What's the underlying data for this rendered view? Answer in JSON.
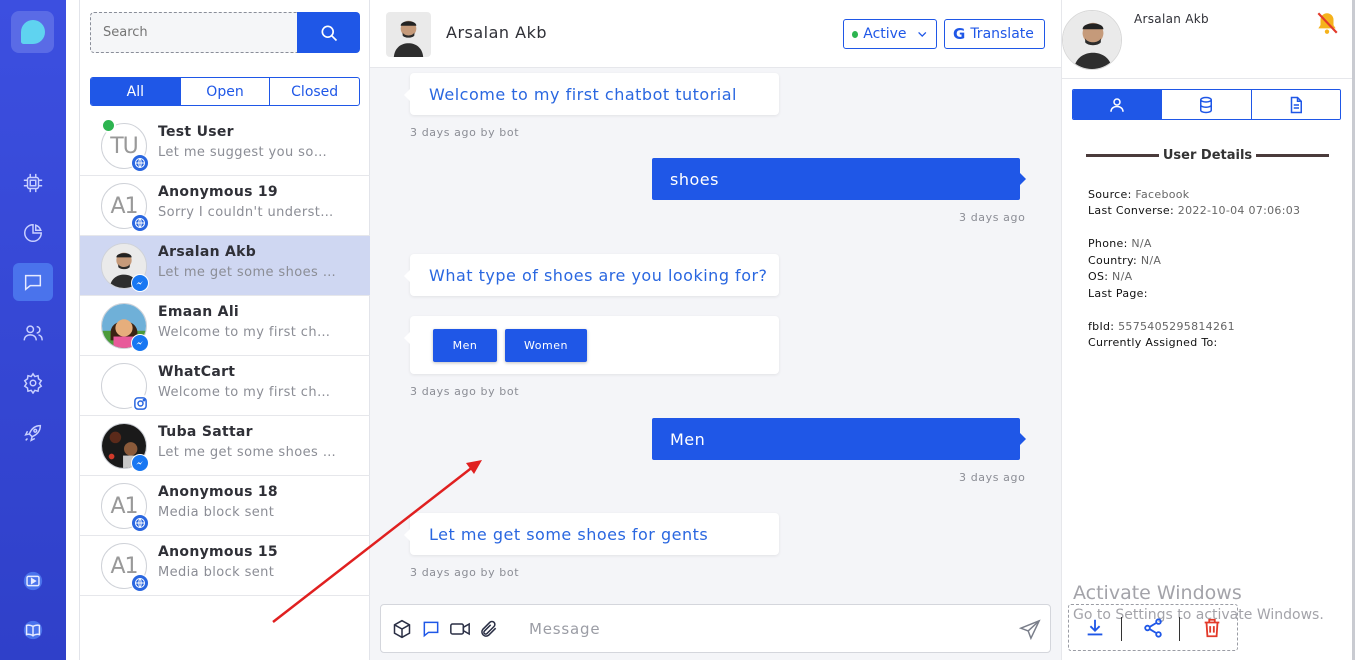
{
  "search": {
    "placeholder": "Search"
  },
  "filters": [
    "All",
    "Open",
    "Closed"
  ],
  "conversations": [
    {
      "initials": "TU",
      "name": "Test User",
      "preview": "Let me suggest you something",
      "channel": "web"
    },
    {
      "initials": "A1",
      "name": "Anonymous 19",
      "preview": "Sorry I couldn't understand that",
      "channel": "web"
    },
    {
      "initials": "",
      "name": "Arsalan Akb",
      "preview": "Let me get some shoes for gents",
      "channel": "messenger"
    },
    {
      "initials": "",
      "name": "Emaan Ali",
      "preview": "Welcome to my first chatbot tutorial",
      "channel": "messenger"
    },
    {
      "initials": "",
      "name": "WhatCart",
      "preview": "Welcome to my first chatbot tutorial",
      "channel": "instagram"
    },
    {
      "initials": "",
      "name": "Tuba Sattar",
      "preview": "Let me get some shoes for gents",
      "channel": "messenger"
    },
    {
      "initials": "A1",
      "name": "Anonymous 18",
      "preview": "Media block sent",
      "channel": "web"
    },
    {
      "initials": "A1",
      "name": "Anonymous 15",
      "preview": "Media block sent",
      "channel": "web"
    }
  ],
  "chat": {
    "contact_name": "Arsalan Akb",
    "status_label": "Active",
    "translate_label": "Translate",
    "messages": [
      {
        "from": "bot",
        "text": "Welcome to my first chatbot tutorial",
        "meta": "3 days ago by bot"
      },
      {
        "from": "user",
        "text": "shoes",
        "meta": "3 days ago"
      },
      {
        "from": "bot",
        "text": "What type of shoes are you looking for?"
      },
      {
        "from": "bot",
        "quick_replies": [
          "Men",
          "Women"
        ],
        "meta": "3 days ago by bot"
      },
      {
        "from": "user",
        "text": "Men",
        "meta": "3 days ago"
      },
      {
        "from": "bot",
        "text": "Let me get some shoes for gents",
        "meta": "3 days ago by bot"
      }
    ],
    "composer_placeholder": "Message"
  },
  "details": {
    "name": "Arsalan Akb",
    "section_title": "User Details",
    "fields": [
      {
        "label": "Source:",
        "value": "Facebook"
      },
      {
        "label": "Last Converse:",
        "value": "2022-10-04 07:06:03"
      },
      {
        "label": "Phone:",
        "value": "N/A"
      },
      {
        "label": "Country:",
        "value": "N/A"
      },
      {
        "label": "OS:",
        "value": "N/A"
      },
      {
        "label": "Last Page:",
        "value": ""
      },
      {
        "label": "fbId:",
        "value": "5575405295814261"
      },
      {
        "label": "Currently Assigned To:",
        "value": ""
      }
    ]
  },
  "watermark": {
    "line1": "Activate Windows",
    "line2": "Go to Settings to activate Windows."
  },
  "colors": {
    "rail": "#3447d6",
    "accent": "#1f57e7",
    "online": "#2db450",
    "selected_row": "#cfd7f2",
    "annotation_arrow": "#e02020"
  }
}
